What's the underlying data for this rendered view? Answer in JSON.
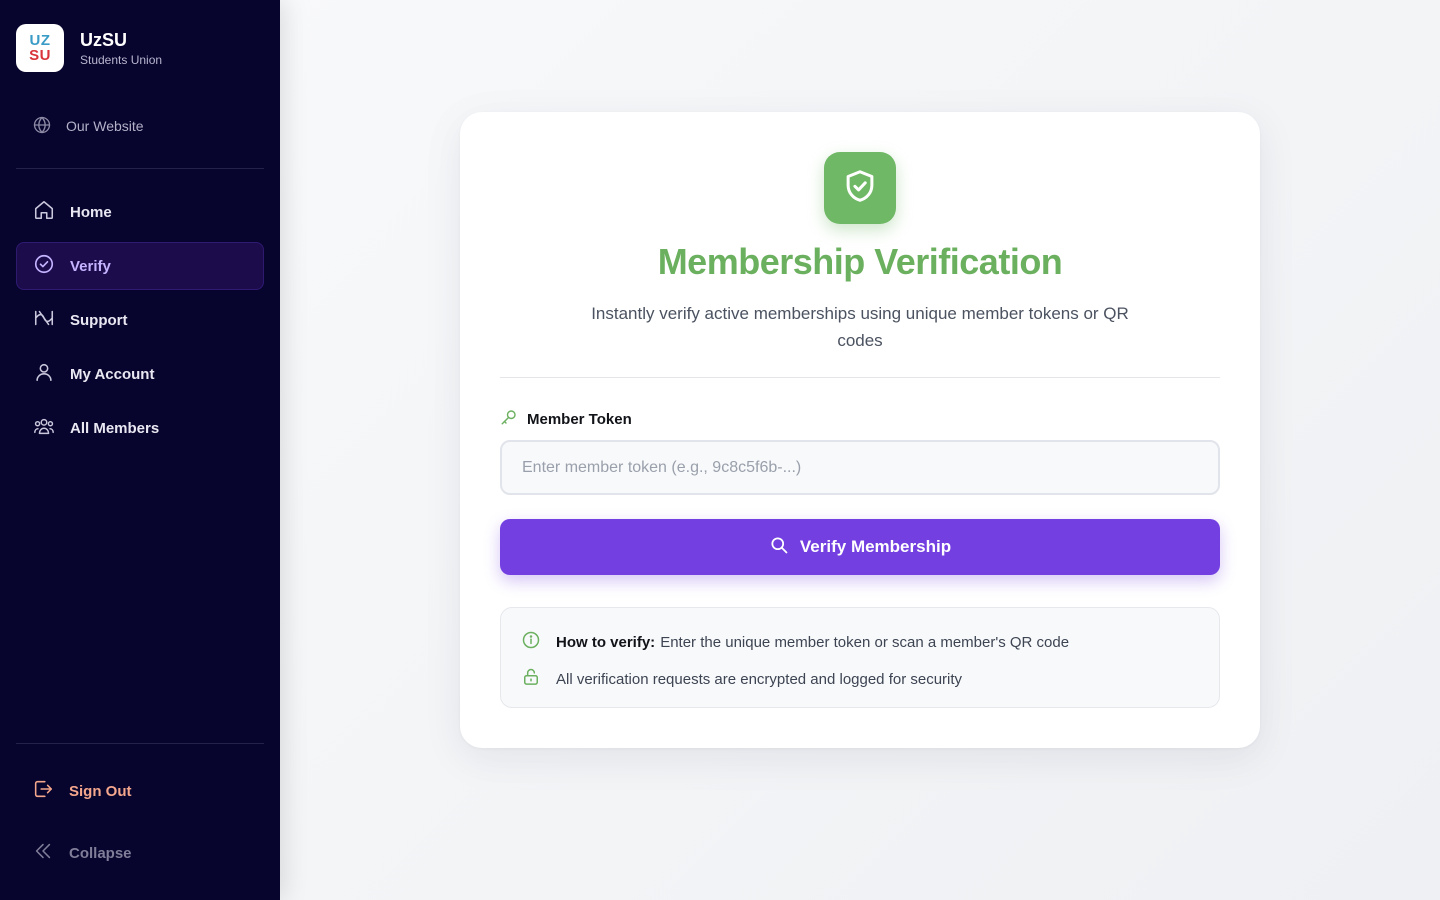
{
  "brand": {
    "logo_line1": "UZ",
    "logo_line2": "SU",
    "name": "UzSU",
    "subtitle": "Students Union"
  },
  "sidebar": {
    "website_label": "Our Website",
    "items": [
      {
        "label": "Home",
        "icon": "home-icon",
        "active": false
      },
      {
        "label": "Verify",
        "icon": "check-circle-icon",
        "active": true
      },
      {
        "label": "Support",
        "icon": "support-icon",
        "active": false
      },
      {
        "label": "My Account",
        "icon": "user-icon",
        "active": false
      },
      {
        "label": "All Members",
        "icon": "users-icon",
        "active": false
      }
    ],
    "sign_out_label": "Sign Out",
    "collapse_label": "Collapse"
  },
  "main": {
    "title": "Membership Verification",
    "subtitle": "Instantly verify active memberships using unique member tokens or QR codes",
    "token_label": "Member Token",
    "token_placeholder": "Enter member token (e.g., 9c8c5f6b-...)",
    "token_value": "",
    "verify_button_label": "Verify Membership",
    "info": {
      "how_to_title": "How to verify:",
      "how_to_text": "Enter the unique member token or scan a member's QR code",
      "security_text": "All verification requests are encrypted and logged for security"
    }
  },
  "colors": {
    "sidebar_bg": "#07042d",
    "accent_purple": "#733fe0",
    "accent_green": "#6bb05f",
    "sign_out": "#f4a78c"
  }
}
